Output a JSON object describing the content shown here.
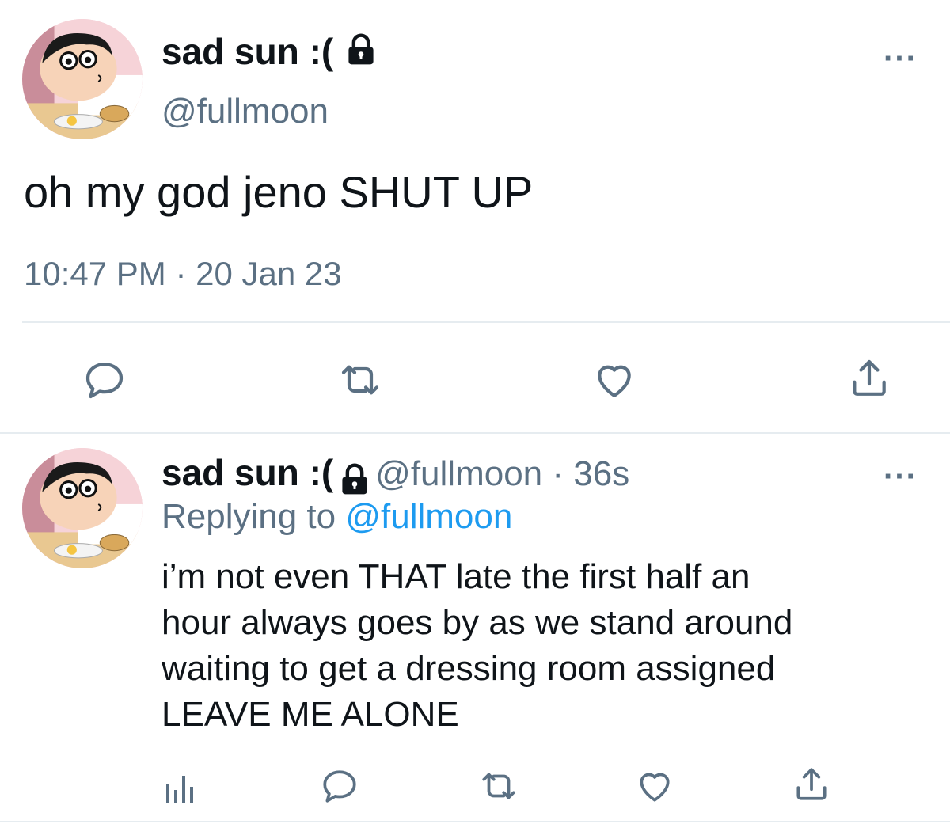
{
  "tweet": {
    "author_name": "sad sun :(",
    "author_handle": "@fullmoon",
    "text": "oh my god jeno SHUT UP",
    "timestamp": "10:47 PM · 20 Jan 23",
    "more_label": "···",
    "actions": [
      "comment-icon",
      "retweet-icon",
      "like-icon",
      "share-icon"
    ]
  },
  "reply": {
    "author_name": "sad sun :(",
    "author_handle": "@fullmoon",
    "separator": " · ",
    "age": "36s",
    "replying_prefix": "Replying to ",
    "replying_handle": "@fullmoon",
    "lines": [
      "i’m not even THAT late the first half an",
      "hour always goes by as we stand around",
      "waiting to get a dressing room assigned",
      "LEAVE ME ALONE"
    ],
    "more_label": "···",
    "actions": [
      "analytics-icon",
      "comment-icon",
      "retweet-icon",
      "like-icon",
      "share-icon"
    ]
  },
  "colors": {
    "text": "#0f1419",
    "muted": "#5b7083",
    "link": "#1d9bf0",
    "divider": "#e6ecf0"
  }
}
